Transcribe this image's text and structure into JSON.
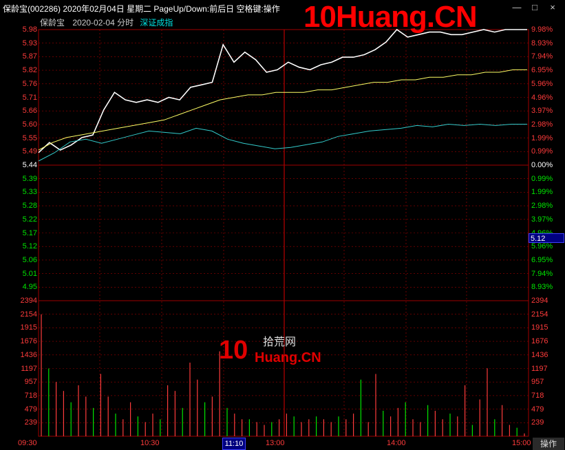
{
  "titlebar": {
    "title": "保龄宝(002286) 2020年02月04日 星期二 PageUp/Down:前后日 空格键:操作",
    "watermark": "10Huang.CN",
    "buttons": [
      "—",
      "□",
      "×"
    ]
  },
  "info": {
    "name": "保龄宝",
    "date": "2020-02-04 分时",
    "index": "深证成指"
  },
  "axis_left_price": [
    "5.98",
    "5.93",
    "5.87",
    "5.82",
    "5.76",
    "5.71",
    "5.66",
    "5.60",
    "5.55",
    "5.49",
    "5.44",
    "5.39",
    "5.33",
    "5.28",
    "5.22",
    "5.17",
    "5.12",
    "5.06",
    "5.01",
    "4.95"
  ],
  "axis_right_pct": [
    "9.98%",
    "8.93%",
    "7.94%",
    "6.95%",
    "5.96%",
    "4.96%",
    "3.97%",
    "2.98%",
    "1.99%",
    "0.99%",
    "0.00%",
    "0.99%",
    "1.99%",
    "2.98%",
    "3.97%",
    "4.96%",
    "5.96%",
    "6.95%",
    "7.94%",
    "8.93%"
  ],
  "axis_volume": [
    "2394",
    "2154",
    "1915",
    "1676",
    "1436",
    "1197",
    "957",
    "718",
    "479",
    "239"
  ],
  "x_labels": [
    "09:30",
    "10:30",
    "13:00",
    "14:00",
    "15:00"
  ],
  "cursor": {
    "time": "11:10",
    "price": "5.12"
  },
  "operate_button": "操作",
  "logo_watermark": {
    "big": "10",
    "cn": "拾荒网",
    "latin": "Huang.CN"
  },
  "colors": {
    "up": "#ff3b3b",
    "down": "#00e600",
    "price_line": "#ffffff",
    "avg_line": "#ffff66",
    "index_line": "#33cccc",
    "grid": "#a00000"
  },
  "chart_data": {
    "type": "line",
    "stock_price_samples": [
      5.49,
      5.53,
      5.5,
      5.52,
      5.55,
      5.56,
      5.66,
      5.73,
      5.7,
      5.69,
      5.7,
      5.69,
      5.71,
      5.7,
      5.75,
      5.76,
      5.77,
      5.92,
      5.85,
      5.89,
      5.86,
      5.81,
      5.82,
      5.85,
      5.83,
      5.82,
      5.84,
      5.85,
      5.87,
      5.87,
      5.88,
      5.9,
      5.93,
      5.98,
      5.95,
      5.96,
      5.97,
      5.97,
      5.96,
      5.96,
      5.97,
      5.98,
      5.97,
      5.98,
      5.98,
      5.98
    ],
    "avg_price_samples": [
      5.5,
      5.53,
      5.55,
      5.56,
      5.57,
      5.58,
      5.59,
      5.6,
      5.61,
      5.62,
      5.64,
      5.66,
      5.68,
      5.7,
      5.71,
      5.72,
      5.72,
      5.73,
      5.73,
      5.73,
      5.74,
      5.74,
      5.75,
      5.76,
      5.77,
      5.77,
      5.78,
      5.78,
      5.79,
      5.79,
      5.8,
      5.8,
      5.81,
      5.81,
      5.82,
      5.82
    ],
    "index_pct_samples": [
      0.3,
      0.9,
      1.7,
      1.9,
      1.6,
      1.9,
      2.2,
      2.5,
      2.4,
      2.3,
      2.7,
      2.5,
      1.9,
      1.6,
      1.4,
      1.2,
      1.3,
      1.5,
      1.7,
      2.1,
      2.3,
      2.5,
      2.6,
      2.7,
      2.9,
      2.8,
      3.0,
      2.9,
      3.0,
      2.9,
      3.0,
      3.0
    ],
    "volume_samples": [
      2154,
      1197,
      957,
      800,
      600,
      900,
      700,
      500,
      1100,
      700,
      400,
      300,
      600,
      350,
      250,
      400,
      300,
      900,
      800,
      500,
      1300,
      1000,
      600,
      700,
      1500,
      500,
      400,
      300,
      300,
      250,
      200,
      250,
      300,
      400,
      350,
      250,
      300,
      350,
      300,
      250,
      350,
      300,
      400,
      1000,
      250,
      1100,
      450,
      350,
      500,
      600,
      300,
      250,
      550,
      450,
      300,
      400,
      350,
      900,
      200,
      650,
      1200,
      300,
      550,
      200,
      150,
      50
    ],
    "ylim_price": [
      4.95,
      5.98
    ],
    "prev_close": 5.44,
    "ylim_volume": [
      0,
      2394
    ]
  }
}
